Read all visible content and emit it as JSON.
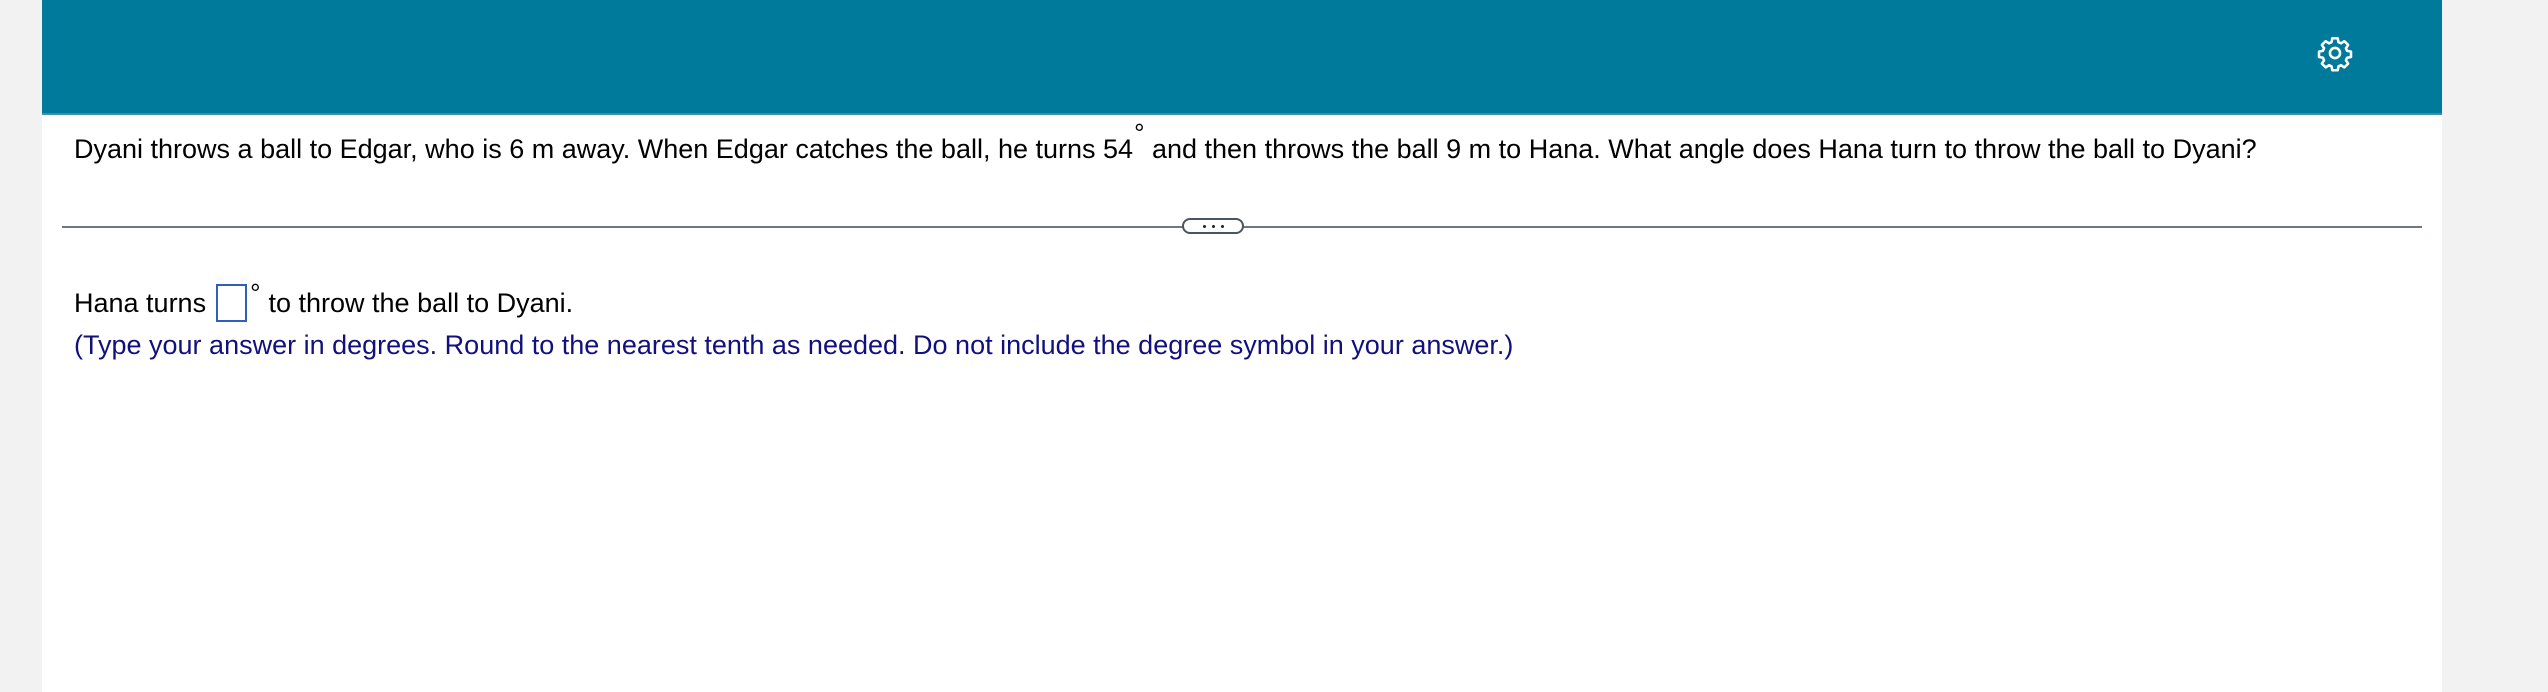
{
  "header": {
    "settings_icon": "gear-icon",
    "colors": {
      "bar": "#007a9a",
      "icon": "#ffffff"
    }
  },
  "question": {
    "text_before": "Dyani throws a ball to Edgar, who is 6 m away. When Edgar catches the ball, he turns 54",
    "degree": "°",
    "text_after": " and then throws the ball 9 m to Hana. What angle does Hana turn to throw the ball to Dyani?"
  },
  "divider": {
    "more_icon": "ellipsis-icon"
  },
  "answer": {
    "prefix": "Hana turns",
    "input_value": "",
    "degree": "°",
    "suffix": "to throw the ball to Dyani."
  },
  "hint": {
    "text": "(Type your answer in degrees. Round to the nearest tenth as needed. Do not include the degree symbol in your answer.)",
    "color": "#12107e"
  }
}
